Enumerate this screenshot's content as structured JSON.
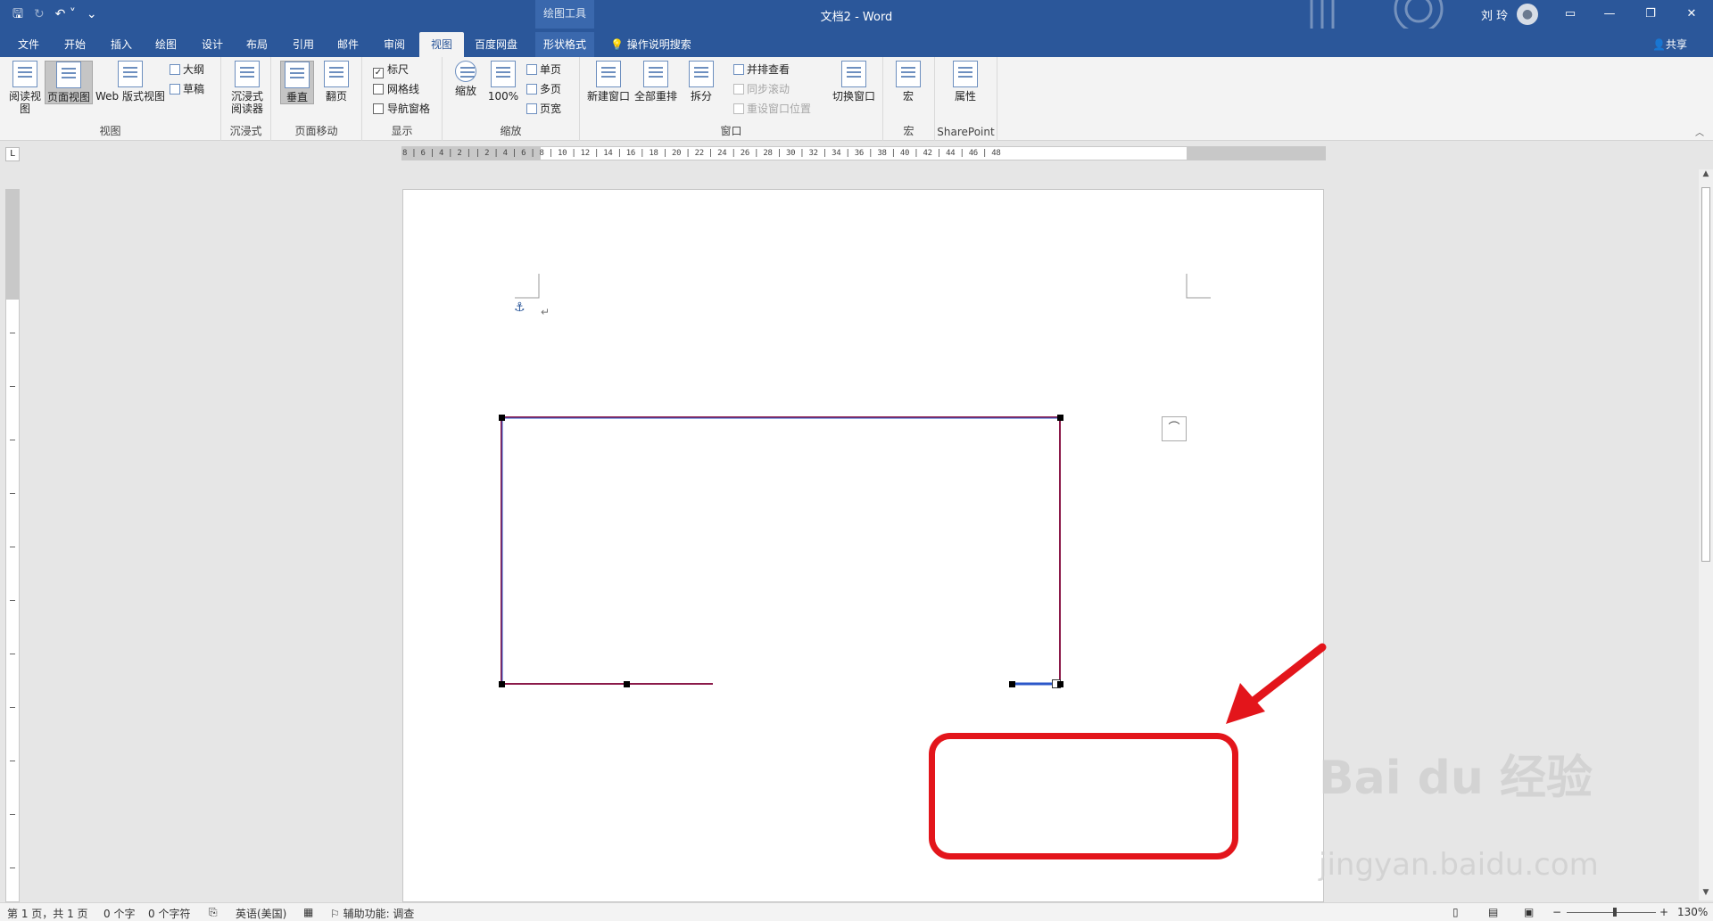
{
  "titlebar": {
    "context_title": "绘图工具",
    "doc_title": "文档2 - Word",
    "user": "刘 玲",
    "qat": {
      "save_icon": "save-icon",
      "undo_icon": "undo-icon",
      "customize_icon": "customize-qat-icon"
    },
    "win": {
      "ribbon_display": "▭",
      "minimize": "—",
      "restore": "❐",
      "close": "✕"
    }
  },
  "tabs": [
    {
      "label": "文件"
    },
    {
      "label": "开始"
    },
    {
      "label": "插入"
    },
    {
      "label": "绘图"
    },
    {
      "label": "设计"
    },
    {
      "label": "布局"
    },
    {
      "label": "引用"
    },
    {
      "label": "邮件"
    },
    {
      "label": "审阅"
    },
    {
      "label": "视图"
    },
    {
      "label": "百度网盘"
    },
    {
      "label": "形状格式"
    }
  ],
  "tellme": "操作说明搜索",
  "share": "共享",
  "ribbon": {
    "view_group": {
      "label": "视图",
      "read": "阅读视图",
      "print": "页面视图",
      "web": "Web 版式视图",
      "outline": "大纲",
      "draft": "草稿"
    },
    "immersive_group": {
      "label": "沉浸式",
      "reader": "沉浸式阅读器"
    },
    "pagemove_group": {
      "label": "页面移动",
      "vertical": "垂直",
      "side": "翻页"
    },
    "show_group": {
      "label": "显示",
      "ruler": "标尺",
      "gridlines": "网格线",
      "nav_pane": "导航窗格"
    },
    "zoom_group": {
      "label": "缩放",
      "zoom": "缩放",
      "hundred": "100%",
      "one_page": "单页",
      "multi_page": "多页",
      "page_width": "页宽"
    },
    "window_group": {
      "label": "窗口",
      "new_window": "新建窗口",
      "arrange_all": "全部重排",
      "split": "拆分",
      "side_by_side": "并排查看",
      "sync_scroll": "同步滚动",
      "reset_pos": "重设窗口位置",
      "switch": "切换窗口"
    },
    "macro_group": {
      "label": "宏",
      "macro": "宏"
    },
    "sp_group": {
      "label": "SharePoint",
      "props": "属性"
    }
  },
  "ruler_ticks": "8 | 6 | 4 | 2 |   | 2 | 4 | 6 | 8 | 10 | 12 | 14 | 16 | 18 | 20 | 22 | 24 | 26 | 28 | 30 | 32 | 34 | 36 | 38 | 40 | 42 | 44 | 46 | 48",
  "ruler_corner": "L",
  "document": {
    "anchor_icon": "anchor-icon",
    "paragraph_mark": "↵",
    "layout_options_icon": "layout-options-icon"
  },
  "watermark": {
    "main": "Bai du 经验",
    "sub": "jingyan.baidu.com"
  },
  "status": {
    "page": "第 1 页，共 1 页",
    "words": "0 个字",
    "chars": "0 个字符",
    "lang": "英语(美国)",
    "accessibility": "辅助功能: 调查",
    "zoom": "130%",
    "zoom_minus": "−",
    "zoom_plus": "+"
  },
  "colors": {
    "brand": "#2b579a",
    "shape_line": "#8b1a4a",
    "selected_segment": "#2b57c9",
    "annotation": "#e3151b"
  }
}
